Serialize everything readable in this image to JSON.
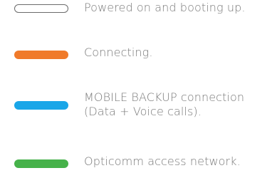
{
  "legend": {
    "items": [
      {
        "text": "Powered on and booting up.",
        "style": "outline",
        "color": "#ffffff",
        "border_color": "#6b6b6b"
      },
      {
        "text": "Connecting.",
        "style": "filled",
        "color": "#f07a2a"
      },
      {
        "text": "MOBILE BACKUP connection\n(Data + Voice calls).",
        "style": "filled",
        "color": "#1aa6e8"
      },
      {
        "text": "Opticomm access network.",
        "style": "filled",
        "color": "#46b24a"
      }
    ]
  }
}
